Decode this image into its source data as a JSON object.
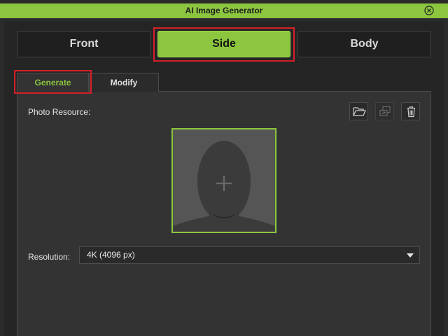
{
  "window": {
    "title": "AI Image Generator",
    "close_icon": "close-circle-icon"
  },
  "modes": [
    {
      "label": "Front",
      "active": false
    },
    {
      "label": "Side",
      "active": true
    },
    {
      "label": "Body",
      "active": false
    }
  ],
  "tabs": [
    {
      "label": "Generate",
      "active": true
    },
    {
      "label": "Modify",
      "active": false
    }
  ],
  "photo_resource": {
    "label": "Photo Resource:",
    "icons": [
      "folder-open-icon",
      "replace-image-icon",
      "trash-icon"
    ]
  },
  "resolution": {
    "label": "Resolution:",
    "value": "4K (4096 px)"
  },
  "colors": {
    "accent": "#8cc63f",
    "highlight": "#d42027",
    "background": "#2b2b2b"
  }
}
